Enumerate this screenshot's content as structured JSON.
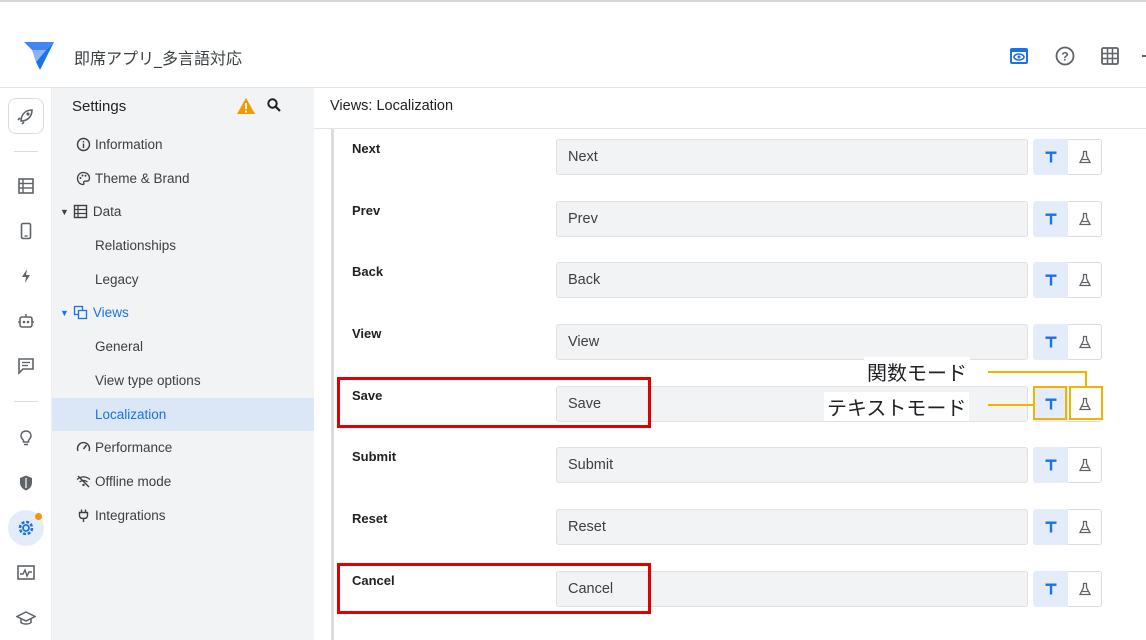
{
  "app": {
    "title": "即席アプリ_多言語対応"
  },
  "topbar": {
    "icons": [
      "preview-icon",
      "help-icon",
      "grid-icon"
    ],
    "accent": "#1a73e8"
  },
  "rail": {
    "icons": [
      "rocket-icon",
      "data-icon",
      "phone-icon",
      "bolt-icon",
      "bot-icon",
      "chat-icon",
      "bulb-icon",
      "shield-icon",
      "gear-icon",
      "monitor-icon",
      "school-icon"
    ]
  },
  "sidebar": {
    "header": "Settings",
    "items": [
      {
        "label": "Information",
        "icon": "info-icon"
      },
      {
        "label": "Theme & Brand",
        "icon": "palette-icon"
      },
      {
        "label": "Data",
        "icon": "table-icon"
      },
      {
        "label": "Relationships"
      },
      {
        "label": "Legacy"
      },
      {
        "label": "Views",
        "icon": "views-icon"
      },
      {
        "label": "General"
      },
      {
        "label": "View type options"
      },
      {
        "label": "Localization"
      },
      {
        "label": "Performance",
        "icon": "speed-icon"
      },
      {
        "label": "Offline mode",
        "icon": "wifi-off-icon"
      },
      {
        "label": "Integrations",
        "icon": "plug-icon"
      }
    ]
  },
  "main": {
    "title": "Views: Localization",
    "rows": [
      {
        "label": "Next",
        "value": "Next"
      },
      {
        "label": "Prev",
        "value": "Prev"
      },
      {
        "label": "Back",
        "value": "Back"
      },
      {
        "label": "View",
        "value": "View"
      },
      {
        "label": "Save",
        "value": "Save"
      },
      {
        "label": "Submit",
        "value": "Submit"
      },
      {
        "label": "Reset",
        "value": "Reset"
      },
      {
        "label": "Cancel",
        "value": "Cancel"
      }
    ]
  },
  "annotations": {
    "function_mode": "関数モード",
    "text_mode": "テキストモード",
    "highlight_color": "#e00000",
    "callout_color": "#f0b400"
  }
}
